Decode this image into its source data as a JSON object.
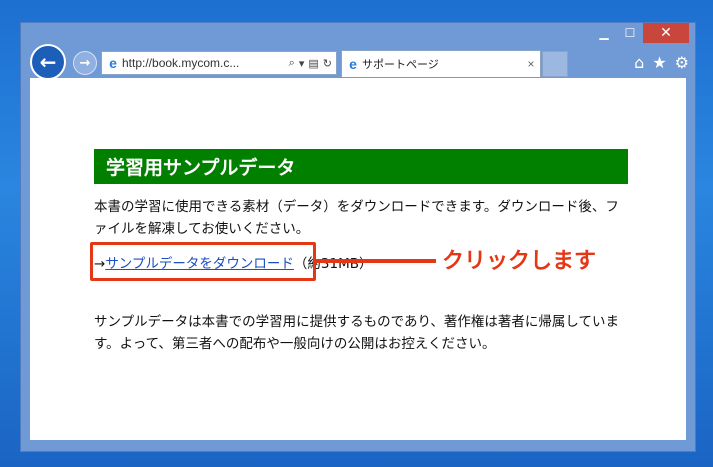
{
  "browser": {
    "address_url": "http://book.mycom.c...",
    "tab_title": "サポートページ",
    "tab_close": "×",
    "min_label": "▁",
    "max_label": "☐",
    "close_label": "✕",
    "back_label": "←",
    "fwd_label": "→",
    "ie_glyph": "e",
    "search_glyph": "⌕",
    "dropdown_glyph": "▾",
    "compat_glyph": "▤",
    "refresh_glyph": "↻",
    "home_glyph": "⌂",
    "fav_glyph": "★",
    "tools_glyph": "⚙"
  },
  "page": {
    "heading": "学習用サンプルデータ",
    "paragraph1": "本書の学習に使用できる素材（データ）をダウンロードできます。ダウンロード後、ファイルを解凍してお使いください。",
    "arrow": "→",
    "download_link": "サンプルデータをダウンロード",
    "download_size": "（約31MB）",
    "paragraph2": "サンプルデータは本書での学習用に提供するものであり、著作権は著者に帰属しています。よって、第三者への配布や一般向けの公開はお控えください。"
  },
  "annotation": {
    "callout": "クリックします",
    "color": "#e53616"
  },
  "colors": {
    "heading_bg": "#018000",
    "link": "#1a4ec4",
    "frame": "#6f9ad6"
  }
}
